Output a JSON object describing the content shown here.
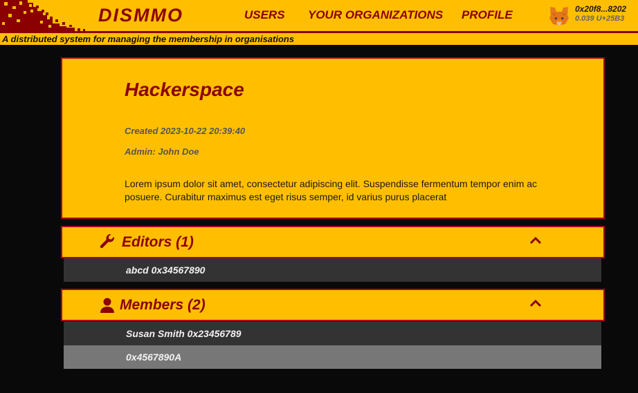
{
  "header": {
    "brand": "DISMMO",
    "nav": {
      "users": "USERS",
      "organizations": "YOUR ORGANIZATIONS",
      "profile": "PROFILE"
    },
    "wallet": {
      "account": "0x20f8...8202",
      "balance": "0.039 U+25B3"
    },
    "tagline": "A distributed system for managing the membership in organisations"
  },
  "organization": {
    "name": "Hackerspace",
    "created": "Created 2023-10-22 20:39:40",
    "admin": "Admin: John Doe",
    "description": "Lorem ipsum dolor sit amet, consectetur adipiscing elit. Suspendisse fermentum tempor enim ac posuere. Curabitur maximus est eget risus semper, id varius purus placerat"
  },
  "editors": {
    "title": "Editors (1)",
    "items": [
      "abcd 0x34567890"
    ]
  },
  "members": {
    "title": "Members (2)",
    "items": [
      "Susan Smith 0x23456789",
      "0x4567890A"
    ]
  },
  "colors": {
    "accent": "#ffbf00",
    "brand": "#8b0000",
    "border": "#b0001e",
    "row_dark": "#333333",
    "row_light": "#777777"
  }
}
